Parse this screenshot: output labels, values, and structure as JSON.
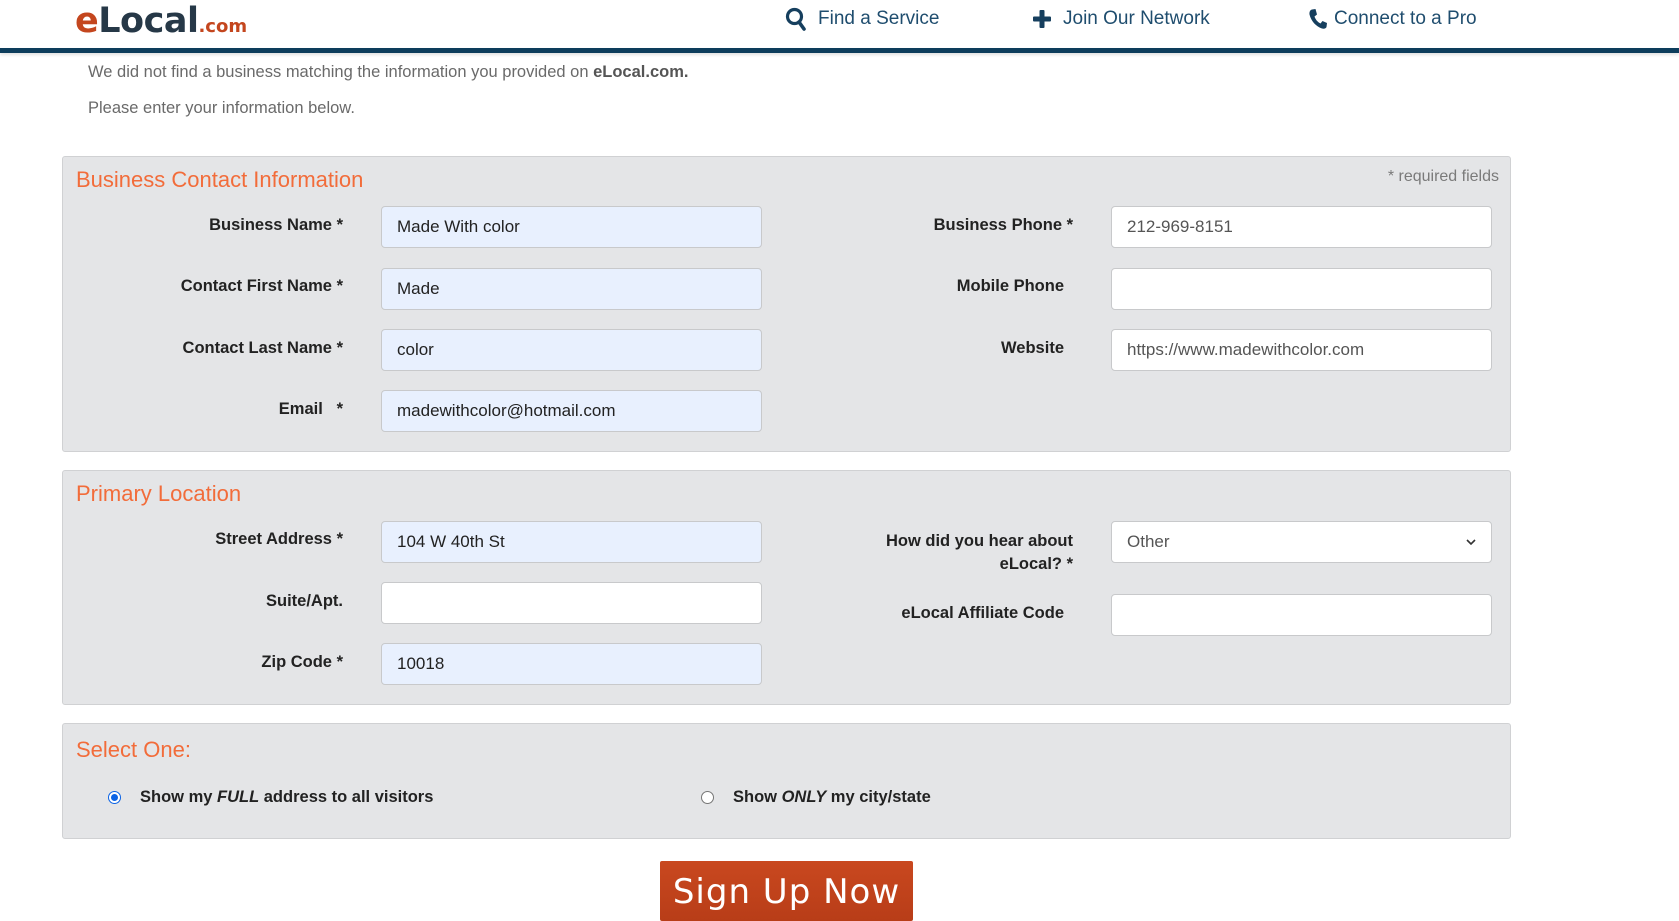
{
  "header": {
    "logo": {
      "e": "e",
      "local": "Local",
      "com": ".com"
    },
    "nav": [
      {
        "label": "Find a Service",
        "icon": "search-icon"
      },
      {
        "label": "Join Our Network",
        "icon": "plus-icon"
      },
      {
        "label": "Connect to a Pro",
        "icon": "phone-icon"
      }
    ],
    "colors": {
      "brand_orange": "#c4461e",
      "brand_navy": "#263847",
      "nav_text": "#1f4d6e",
      "bar": "#0d3d5c"
    }
  },
  "intro": {
    "line1_prefix": "We did not find a business matching the information you provided on ",
    "line1_bold": "eLocal.com.",
    "line2": "Please enter your information below."
  },
  "contact": {
    "title": "Business Contact Information",
    "required_note": "* required fields",
    "left_fields": [
      {
        "label": "Business Name *",
        "value": "Made With color"
      },
      {
        "label": "Contact First Name *",
        "value": "Made"
      },
      {
        "label": "Contact Last Name *",
        "value": "color"
      },
      {
        "label": "Email   *",
        "value": "madewithcolor@hotmail.com"
      }
    ],
    "right_fields": [
      {
        "label": "Business Phone *",
        "value": "212-969-8151"
      },
      {
        "label": "Mobile Phone",
        "value": ""
      },
      {
        "label": "Website",
        "value": "https://www.madewithcolor.com"
      }
    ]
  },
  "location": {
    "title": "Primary Location",
    "left_fields": [
      {
        "label": "Street Address *",
        "value": "104 W 40th St"
      },
      {
        "label": "Suite/Apt.",
        "value": ""
      },
      {
        "label": "Zip Code *",
        "value": "10018"
      }
    ],
    "hear_about": {
      "label_line1": "How did you hear about",
      "label_line2": "eLocal? *",
      "selected": "Other"
    },
    "affiliate": {
      "label": "eLocal Affiliate Code",
      "value": ""
    }
  },
  "display_option": {
    "title": "Select One:",
    "options": [
      {
        "pre": "Show my ",
        "em": "FULL",
        "post": " address to all visitors",
        "checked": true
      },
      {
        "pre": "Show ",
        "em": "ONLY",
        "post": " my city/state",
        "checked": false
      }
    ]
  },
  "submit": {
    "label": "Sign Up Now",
    "color": "#c0431c"
  },
  "accent_colors": {
    "section_title": "#f26c3a",
    "autofill_bg": "#e8f0fe",
    "panel_bg": "#e4e5e7"
  }
}
